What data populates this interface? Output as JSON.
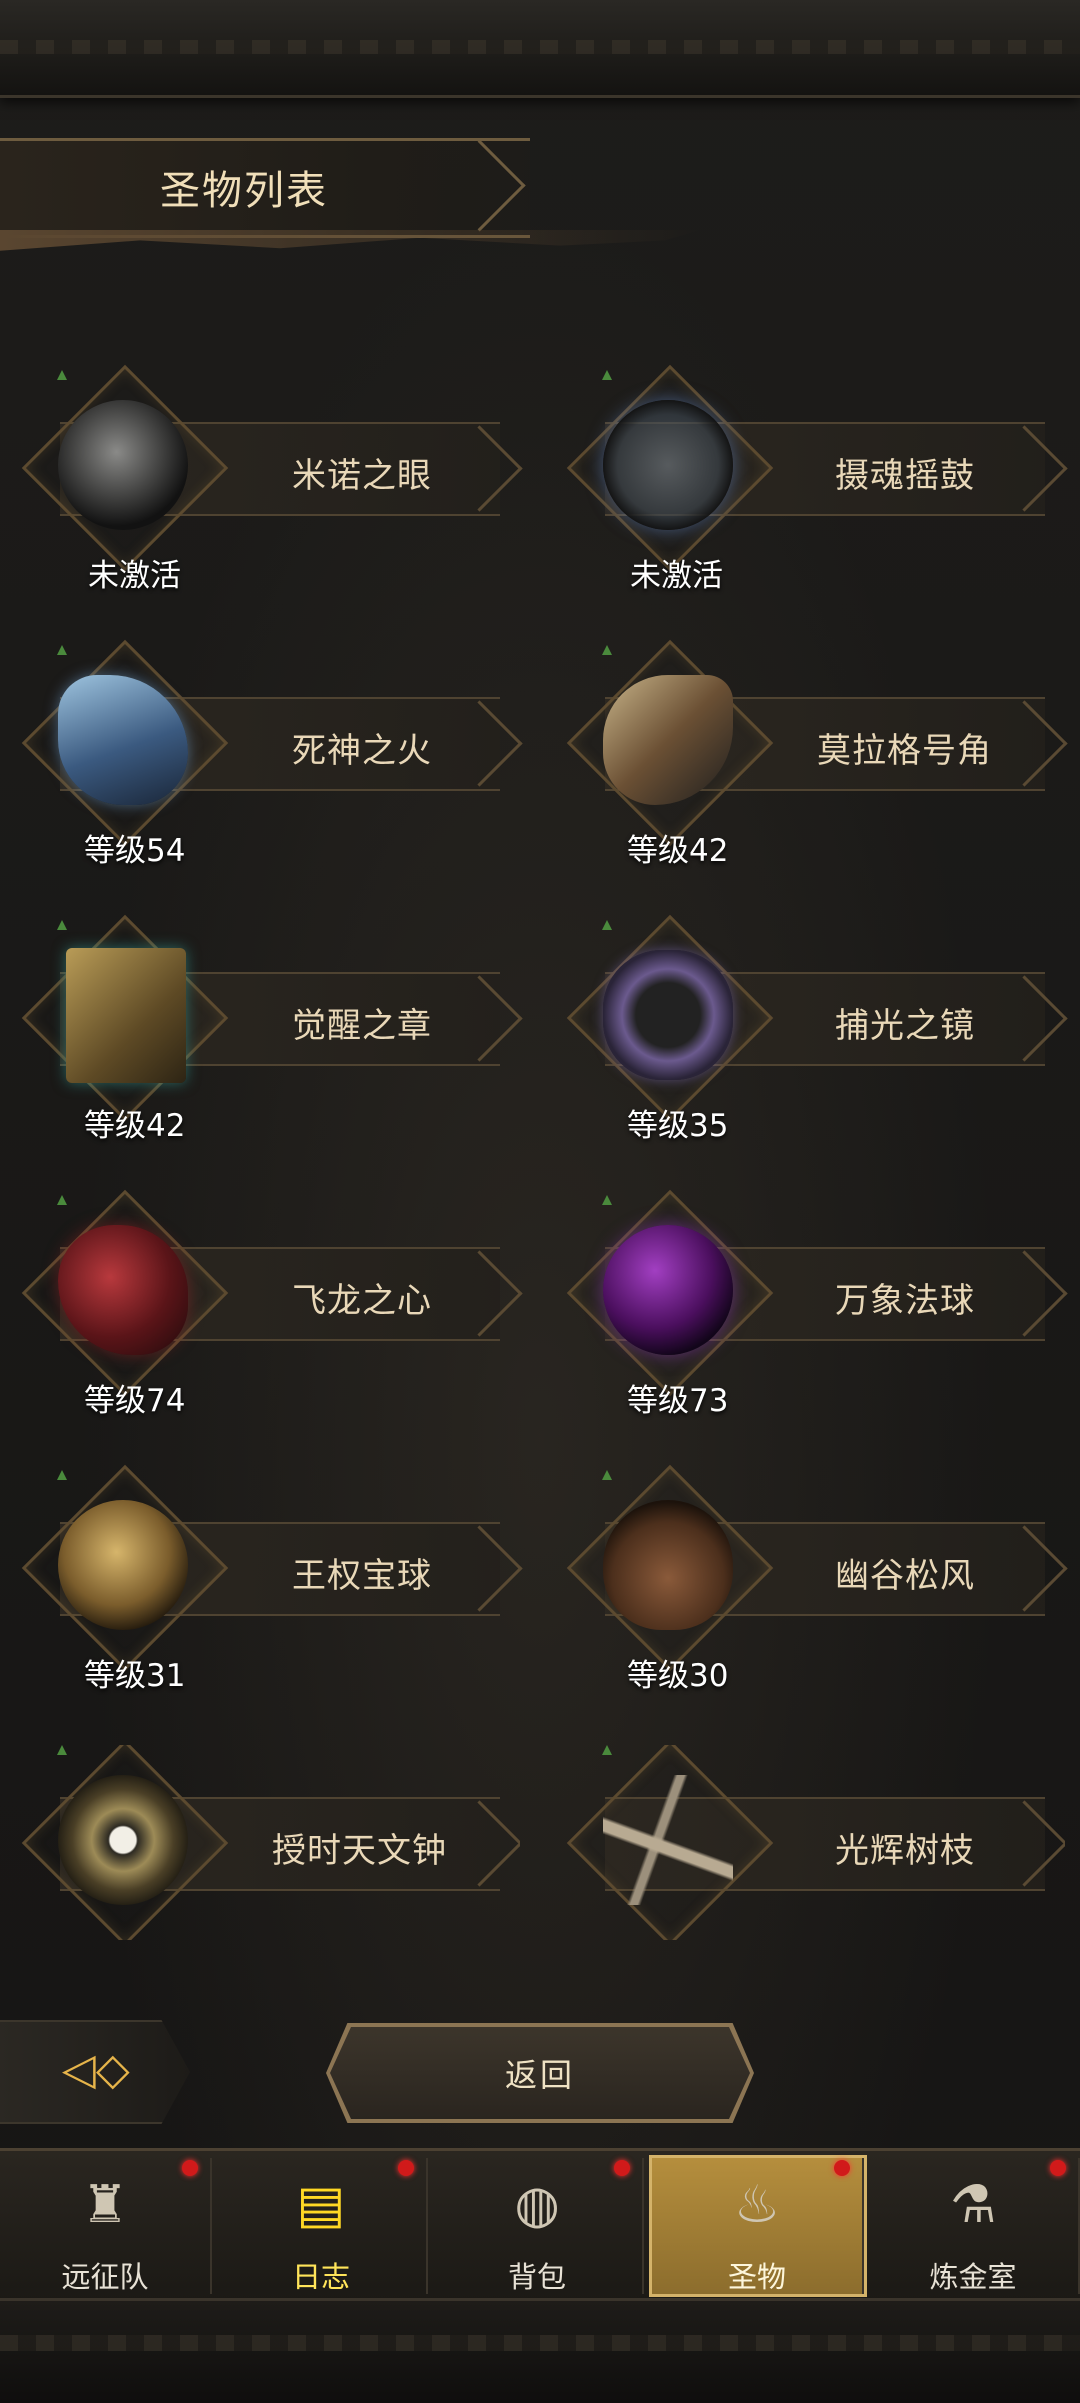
{
  "header": {
    "title": "圣物列表"
  },
  "relics": [
    {
      "name": "米诺之眼",
      "status": "未激活",
      "art": "eye-relic"
    },
    {
      "name": "摄魂摇鼓",
      "status": "未激活",
      "art": "drum-relic"
    },
    {
      "name": "死神之火",
      "status": "等级54",
      "art": "spectral-hand-relic"
    },
    {
      "name": "莫拉格号角",
      "status": "等级42",
      "art": "horn-relic"
    },
    {
      "name": "觉醒之章",
      "status": "等级42",
      "art": "book-relic"
    },
    {
      "name": "捕光之镜",
      "status": "等级35",
      "art": "mirror-relic"
    },
    {
      "name": "飞龙之心",
      "status": "等级74",
      "art": "heart-relic"
    },
    {
      "name": "万象法球",
      "status": "等级73",
      "art": "orb-relic"
    },
    {
      "name": "王权宝球",
      "status": "等级31",
      "art": "globe-relic"
    },
    {
      "name": "幽谷松风",
      "status": "等级30",
      "art": "lute-relic"
    },
    {
      "name": "授时天文钟",
      "status": "",
      "art": "astrolabe-clock-relic"
    },
    {
      "name": "光辉树枝",
      "status": "",
      "art": "branch-relic"
    }
  ],
  "footer": {
    "back_label": "返回"
  },
  "nav": [
    {
      "label": "远征队",
      "icon": "helmet-icon",
      "badge": true
    },
    {
      "label": "日志",
      "icon": "scroll-icon",
      "badge": true
    },
    {
      "label": "背包",
      "icon": "backpack-icon",
      "badge": true
    },
    {
      "label": "圣物",
      "icon": "relic-brazier-icon",
      "badge": true,
      "active": true
    },
    {
      "label": "炼金室",
      "icon": "alchemy-icon",
      "badge": true
    }
  ],
  "colors": {
    "accent_gold": "#b58e3d",
    "badge_red": "#d11a1a",
    "text_cream": "#e9d8b8"
  }
}
